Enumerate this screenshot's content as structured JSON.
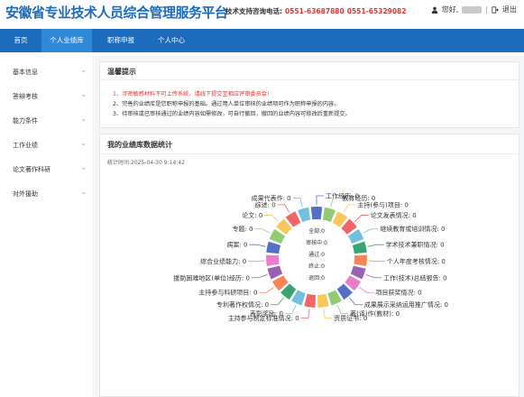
{
  "header": {
    "logo": "安徽省专业技术人员综合管理服务平台",
    "hotline_label": "技术支持咨询电话:",
    "hotline_1": "0551-63687880",
    "hotline_2": "0551-65329082",
    "greeting": "您好,",
    "logout": "退出"
  },
  "nav": {
    "items": [
      "首页",
      "个人业绩库",
      "职称申报",
      "个人中心"
    ],
    "active_index": 1
  },
  "sidebar": {
    "items": [
      "基本信息",
      "答辩考核",
      "能力条件",
      "工作业绩",
      "论文著作科研",
      "对外援助"
    ]
  },
  "notice": {
    "title": "温馨提示",
    "lines": [
      "1、涉密敏感材料不可上传系统，请线下提交至相应评审委员会!",
      "2、完善的业绩库是您职称申报的基础。通过用人单位审核的业绩项可作为职称申报的内容。",
      "3、待审核或已审核通过的业绩内容如需修改，可自行撤回，撤回的业绩内容可修改后重新提交。"
    ]
  },
  "stats": {
    "title": "我的业绩库数据统计",
    "time_label": "统计时间:",
    "time_value": "2025-04-30 9:14:42",
    "center": [
      {
        "label": "全部",
        "value": 0
      },
      {
        "label": "审核中",
        "value": 0
      },
      {
        "label": "通过",
        "value": 0
      },
      {
        "label": "终止",
        "value": 0
      },
      {
        "label": "退回",
        "value": 0
      }
    ]
  },
  "chart_data": {
    "type": "pie",
    "categories": [
      "工作经历",
      "教育经历",
      "主持(参与)项目",
      "论文发表情况",
      "继续教育或培训情况",
      "学术技术兼职情况",
      "个人年度考核情况",
      "工作(技术)总结报告",
      "项目获奖情况",
      "成果展示采纳运用推广情况",
      "著(译)作(教材)",
      "资质证书",
      "主持参与制定标准情况",
      "表彰奖励",
      "专利著作权情况",
      "主持参与科研项目",
      "援助困难地区(单位)经历",
      "综合业绩能力",
      "病案",
      "专题",
      "论文",
      "综述",
      "成果代表作"
    ],
    "values": [
      0,
      0,
      0,
      0,
      0,
      0,
      0,
      0,
      0,
      0,
      0,
      0,
      0,
      0,
      0,
      0,
      0,
      0,
      0,
      0,
      0,
      0,
      0
    ],
    "colors": [
      "#5470c6",
      "#91cc75",
      "#fac858",
      "#ee6666",
      "#73c0de",
      "#3ba272",
      "#fc8452",
      "#9a60b4",
      "#ea7ccc",
      "#5470c6",
      "#91cc75",
      "#fac858",
      "#ee6666",
      "#73c0de",
      "#3ba272",
      "#fc8452",
      "#9a60b4",
      "#ea7ccc",
      "#5470c6",
      "#91cc75",
      "#fac858",
      "#ee6666",
      "#73c0de"
    ]
  },
  "colors": {
    "brand": "#1d6bbd",
    "nav_active": "#2f88d8",
    "alert": "#e8322f"
  }
}
